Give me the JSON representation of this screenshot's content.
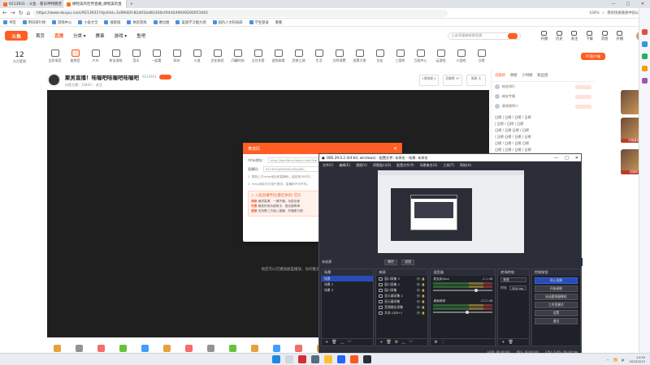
{
  "browser": {
    "tabs": [
      {
        "label": "9213931 - 斗鱼 - 看日神特朗普",
        "active": false
      },
      {
        "label": "硬哈美的巨界直播_硬哈美的直",
        "active": true
      }
    ],
    "new_tab": "+",
    "window_controls": [
      "—",
      "□",
      "✕"
    ],
    "url": "https://www.douyu.com/9213931?dyshid=3c89d20-82d01bd83160cf44d2d9049200051601",
    "zoom": "100%",
    "right_text": "我的快速链接中国公司",
    "bookmarks": [
      "书签",
      "用日排行榜",
      "游戏中心",
      "小说大全",
      "搜索城",
      "体验游戏",
      "要比图",
      "美国学习能力测",
      "国内人文科技研",
      "学生登录"
    ],
    "bookmark_extra": "看看"
  },
  "site": {
    "logo": "斗鱼",
    "menu": [
      "首页",
      "直播",
      "分类 ▾",
      "赛事",
      "游戏 ▾",
      "鱼吧"
    ],
    "menu_active_index": 1,
    "search_placeholder": "王者荣耀巅峰赛直播",
    "header_icons": [
      "开播",
      "历史",
      "关注",
      "下载",
      "消息",
      "开播"
    ],
    "date_day": "12",
    "date_label": "大月签到",
    "categories": [
      "全民电竞",
      "鉴赏官",
      "户外",
      "射击游戏",
      "音乐",
      "一起看",
      "科技",
      "小说",
      "文化体验",
      "闪耀时刻",
      "五谷丰登",
      "游戏体育",
      "武侠江湖",
      "生活",
      "文明消费",
      "投票大赏",
      "交友",
      "三国杀",
      "互助中心",
      "云游戏",
      "小游戏",
      "日榜"
    ],
    "pc_button": "PC客户端",
    "room": {
      "title": "聚男直播！哇喔吧哇喔吧哇喔吧",
      "id": "9213931",
      "follow": "关注",
      "sub": "抖鱼主播 · 1184人 · 关注",
      "stats": [
        "1周热度 0",
        "贡献榜 37",
        "周星 大"
      ]
    },
    "player_text": "他还可以在播放器里播放，访问推流码的地图博主",
    "chat": {
      "tabs": [
        "贡献榜",
        "周榜",
        "小时榜",
        "粉丝团"
      ],
      "ranks": [
        "粉丝排行",
        "粉丝专属",
        "贵宾席特人"
      ],
      "messages": [
        "日榜 | 日榜 / 日榜 / 日榜",
        "| 日榜 / 日榜 | 日榜",
        "日榜 / 日榜 日榜 / 日榜",
        "/ 日榜 日榜 / 日榜 | 日榜",
        "日榜 / 日榜 / 日榜 日榜",
        "日榜 | 日榜 / 日榜 / 日榜"
      ]
    },
    "ads": [
      "开服盛宴",
      "兑换码"
    ]
  },
  "modal": {
    "title": "推流码",
    "close": "✕",
    "rtmp_label": "rtmp地址：",
    "rtmp_value": "rtmp://sendfw-a.douyu.com/live",
    "key_label": "直播码：",
    "key_value": "9213931bRHR4DcM9ytf6r...",
    "tip1": "1. 复制上方rtmp地址和直播码，粘贴到OBS中。",
    "tip2": "2. rtmp地址仅可用于推流，直播码不可外传。",
    "warn_title": "⚠ 斗鱼直播伴侣(最佳体验) 官方",
    "warn_lines": [
      "画质高清、一键开播，功能全面",
      "精选好用功能助手，推流超简单",
      "支持第三方接入直播，开播更方便"
    ],
    "warn_tags": [
      "清晰",
      "可靠",
      "便捷"
    ]
  },
  "obs": {
    "title": "OBS 29.0.2 (64 bit, windows) - 配置文件: 未命名 - 场景: 未命名",
    "menu": [
      "文件(F)",
      "编辑(E)",
      "视图(V)",
      "停靠窗口(D)",
      "配置文件(P)",
      "场景集合(S)",
      "工具(T)",
      "帮助(H)"
    ],
    "toolbar": [
      "未选源",
      "属性",
      "滤镜"
    ],
    "scenes": {
      "title": "场景",
      "items": [
        "场景",
        "场景 2",
        "场景 3"
      ]
    },
    "sources": {
      "title": "来源",
      "items": [
        "窗口采集 3",
        "窗口采集 2",
        "窗口采集",
        "显示器采集 2",
        "显示器采集",
        "音频输出采集",
        "文本 (GDI+)"
      ]
    },
    "mixer": {
      "title": "混音器",
      "channels": [
        {
          "name": "麦克风/Aux",
          "db": "-2.1 dB"
        },
        {
          "name": "桌面音频",
          "db": "-13.2 dB"
        }
      ]
    },
    "transitions": {
      "title": "转场特效",
      "type": "渐变",
      "duration_label": "时长",
      "duration": "300 ms"
    },
    "controls": {
      "title": "控制按钮",
      "buttons": [
        "停止直播",
        "开始录制",
        "启动虚拟摄像机",
        "工作室模式",
        "设置",
        "退出"
      ]
    },
    "status": [
      "LIVE: 00:00:00",
      "REC: 00:00:00",
      "CPU: 3.0%, 60.00 fps"
    ]
  },
  "taskbar": {
    "time": "14:30",
    "date": "2023/2/12"
  }
}
